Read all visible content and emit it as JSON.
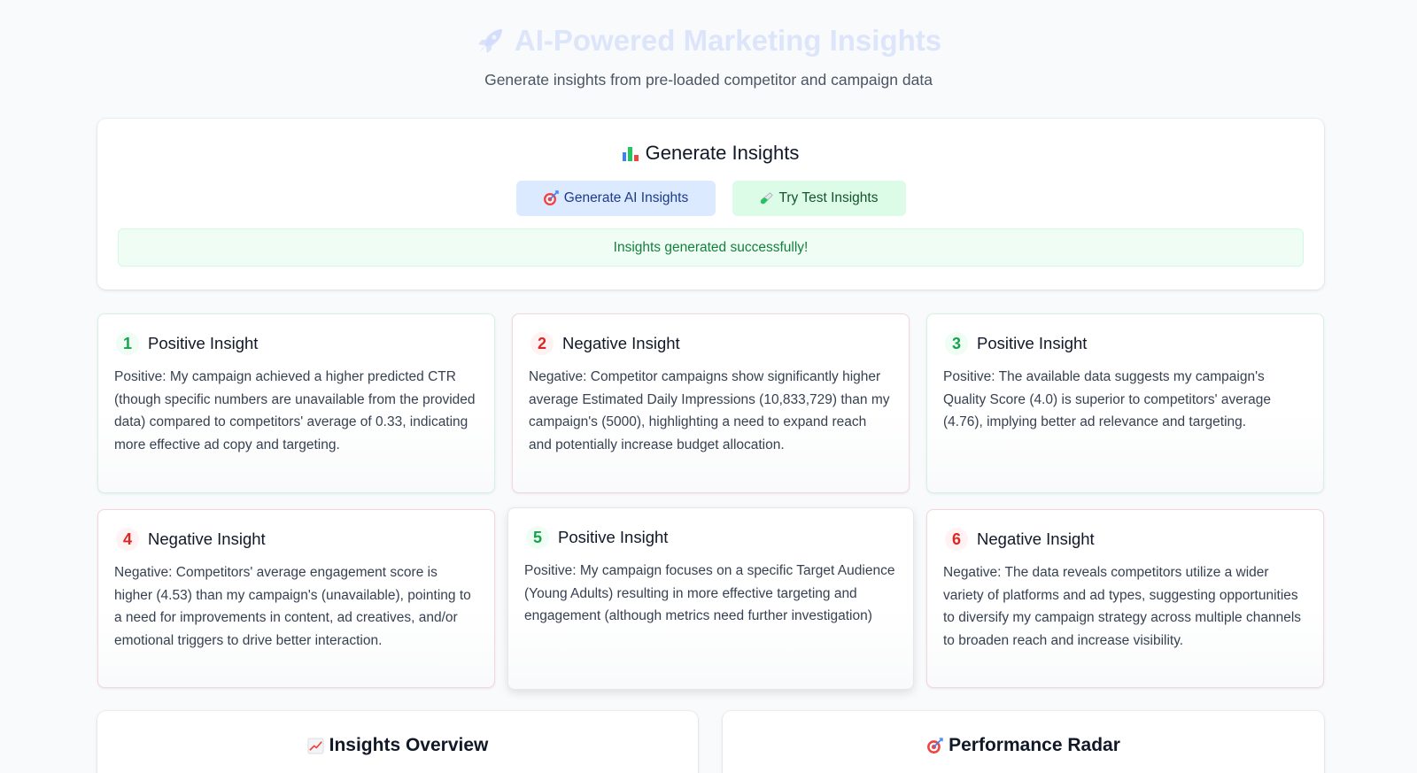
{
  "header": {
    "title": "AI-Powered Marketing Insights",
    "subtitle": "Generate insights from pre-loaded competitor and campaign data"
  },
  "generate": {
    "title": "Generate Insights",
    "ai_button": "Generate AI Insights",
    "test_button": "Try Test Insights",
    "status": "Insights generated successfully!"
  },
  "insights": [
    {
      "number": "1",
      "title": "Positive Insight",
      "type": "positive",
      "text": "Positive: My campaign achieved a higher predicted CTR (though specific numbers are unavailable from the provided data) compared to competitors' average of 0.33, indicating more effective ad copy and targeting."
    },
    {
      "number": "2",
      "title": "Negative Insight",
      "type": "negative",
      "text": "Negative: Competitor campaigns show significantly higher average Estimated Daily Impressions (10,833,729) than my campaign's (5000), highlighting a need to expand reach and potentially increase budget allocation."
    },
    {
      "number": "3",
      "title": "Positive Insight",
      "type": "positive",
      "text": "Positive: The available data suggests my campaign's Quality Score (4.0) is superior to competitors' average (4.76), implying better ad relevance and targeting."
    },
    {
      "number": "4",
      "title": "Negative Insight",
      "type": "negative",
      "text": "Negative: Competitors' average engagement score is higher (4.53) than my campaign's (unavailable), pointing to a need for improvements in content, ad creatives, and/or emotional triggers to drive better interaction."
    },
    {
      "number": "5",
      "title": "Positive Insight",
      "type": "positive",
      "text": "Positive: My campaign focuses on a specific Target Audience (Young Adults) resulting in more effective targeting and engagement (although metrics need further investigation)"
    },
    {
      "number": "6",
      "title": "Negative Insight",
      "type": "negative",
      "text": "Negative: The data reveals competitors utilize a wider variety of platforms and ad types, suggesting opportunities to diversify my campaign strategy across multiple channels to broaden reach and increase visibility."
    }
  ],
  "panels": {
    "overview_title": "Insights Overview",
    "radar_title": "Performance Radar"
  },
  "colors": {
    "positive": "#16a34a",
    "negative": "#dc2626",
    "title_faded": "#dde5fb",
    "ai_button_bg": "#dbeafe",
    "test_button_bg": "#dcfce7"
  }
}
